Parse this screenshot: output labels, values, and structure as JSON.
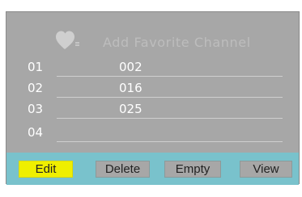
{
  "header": {
    "title": "Add Favorite Channel",
    "icon": "heart-icon"
  },
  "rows": [
    {
      "index": "01",
      "channel": "002"
    },
    {
      "index": "02",
      "channel": "016"
    },
    {
      "index": "03",
      "channel": "025"
    },
    {
      "index": "04",
      "channel": ""
    }
  ],
  "buttons": {
    "edit": "Edit",
    "delete": "Delete",
    "empty": "Empty",
    "view": "View"
  },
  "colors": {
    "panel": "#a7a7a7",
    "bottom_bar": "#79c2cc",
    "selected_button": "#efef00"
  }
}
